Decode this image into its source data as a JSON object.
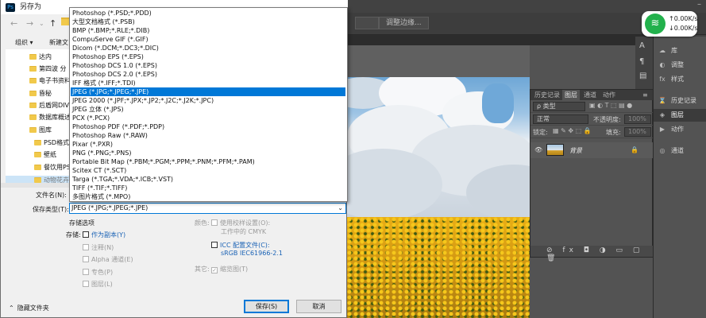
{
  "dialog": {
    "title": "另存为",
    "nav": {
      "back": "←",
      "forward": "→",
      "up": "↑"
    },
    "toolbar": {
      "organize": "组织 ▾",
      "new_folder": "新建文"
    },
    "sidebar": [
      "达内",
      "第四波 分",
      "电子书资料",
      "昏秘",
      "后盾网DIV",
      "数据库概述",
      "图库",
      "PSD格式",
      "壁纸",
      "餐饮用PS",
      "动物花卉"
    ],
    "format_list": [
      "Photoshop (*.PSD;*.PDD)",
      "大型文档格式 (*.PSB)",
      "BMP (*.BMP;*.RLE;*.DIB)",
      "CompuServe GIF (*.GIF)",
      "Dicom (*.DCM;*.DC3;*.DIC)",
      "Photoshop EPS (*.EPS)",
      "Photoshop DCS 1.0 (*.EPS)",
      "Photoshop DCS 2.0 (*.EPS)",
      "IFF 格式 (*.IFF;*.TDI)",
      "JPEG (*.JPG;*.JPEG;*.JPE)",
      "JPEG 2000 (*.JPF;*.JPX;*.JP2;*.J2C;*.J2K;*.JPC)",
      "JPEG 立体 (*.JPS)",
      "PCX (*.PCX)",
      "Photoshop PDF (*.PDF;*.PDP)",
      "Photoshop Raw (*.RAW)",
      "Pixar (*.PXR)",
      "PNG (*.PNG;*.PNS)",
      "Portable Bit Map (*.PBM;*.PGM;*.PPM;*.PNM;*.PFM;*.PAM)",
      "Scitex CT (*.SCT)",
      "Targa (*.TGA;*.VDA;*.ICB;*.VST)",
      "TIFF (*.TIF;*.TIFF)",
      "多图片格式 (*.MPO)"
    ],
    "selected_format_index": 9,
    "filename_label": "文件名(N):",
    "type_label": "保存类型(T):",
    "type_value": "JPEG (*.JPG;*.JPEG;*.JPE)",
    "save_options_title": "存储选项",
    "save_label": "存储:",
    "as_copy": "作为副本(Y)",
    "notes": "注释(N)",
    "alpha": "Alpha 通道(E)",
    "spot": "专色(P)",
    "layers": "图层(L)",
    "color_label": "颜色:",
    "use_proof": "使用校样设置(O):",
    "proof_value": "工作中的 CMYK",
    "icc": "ICC 配置文件(C):",
    "icc_value": "sRGB IEC61966-2.1",
    "other_label": "其它:",
    "thumbnail": "缩览图(T)",
    "hide_folders": "隐藏文件夹",
    "save_button": "保存(S)",
    "cancel_button": "取消"
  },
  "photoshop": {
    "adjust_edge": "调整边缘...",
    "network": {
      "speed_up": "0.00K/s",
      "speed_down": "0.00K/s"
    },
    "layers_panel": {
      "tabs": [
        "历史记录",
        "图层",
        "通道",
        "动作"
      ],
      "kind": "类型",
      "blend": "正常",
      "opacity_label": "不透明度:",
      "opacity": "100%",
      "lock_label": "锁定:",
      "fill_label": "填充:",
      "fill": "100%",
      "layer_name": "背景"
    },
    "right_panel": [
      "库",
      "调整",
      "样式",
      "历史记录",
      "图层",
      "动作",
      "通道"
    ]
  }
}
